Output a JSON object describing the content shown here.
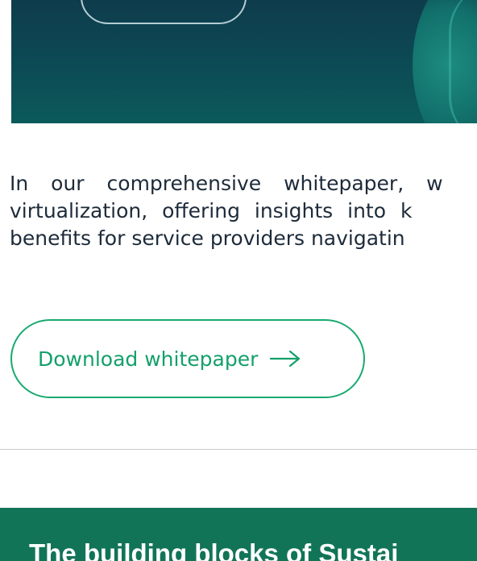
{
  "intro": {
    "line1": "In our comprehensive whitepaper, w",
    "line2": "virtualization, offering insights into k",
    "line3": "benefits for service providers navigatin"
  },
  "download": {
    "label": "Download whitepaper",
    "icon": "arrow-right-icon",
    "color": "#13a06b"
  },
  "section": {
    "title": "The building blocks of Sustai",
    "background": "#127457"
  }
}
